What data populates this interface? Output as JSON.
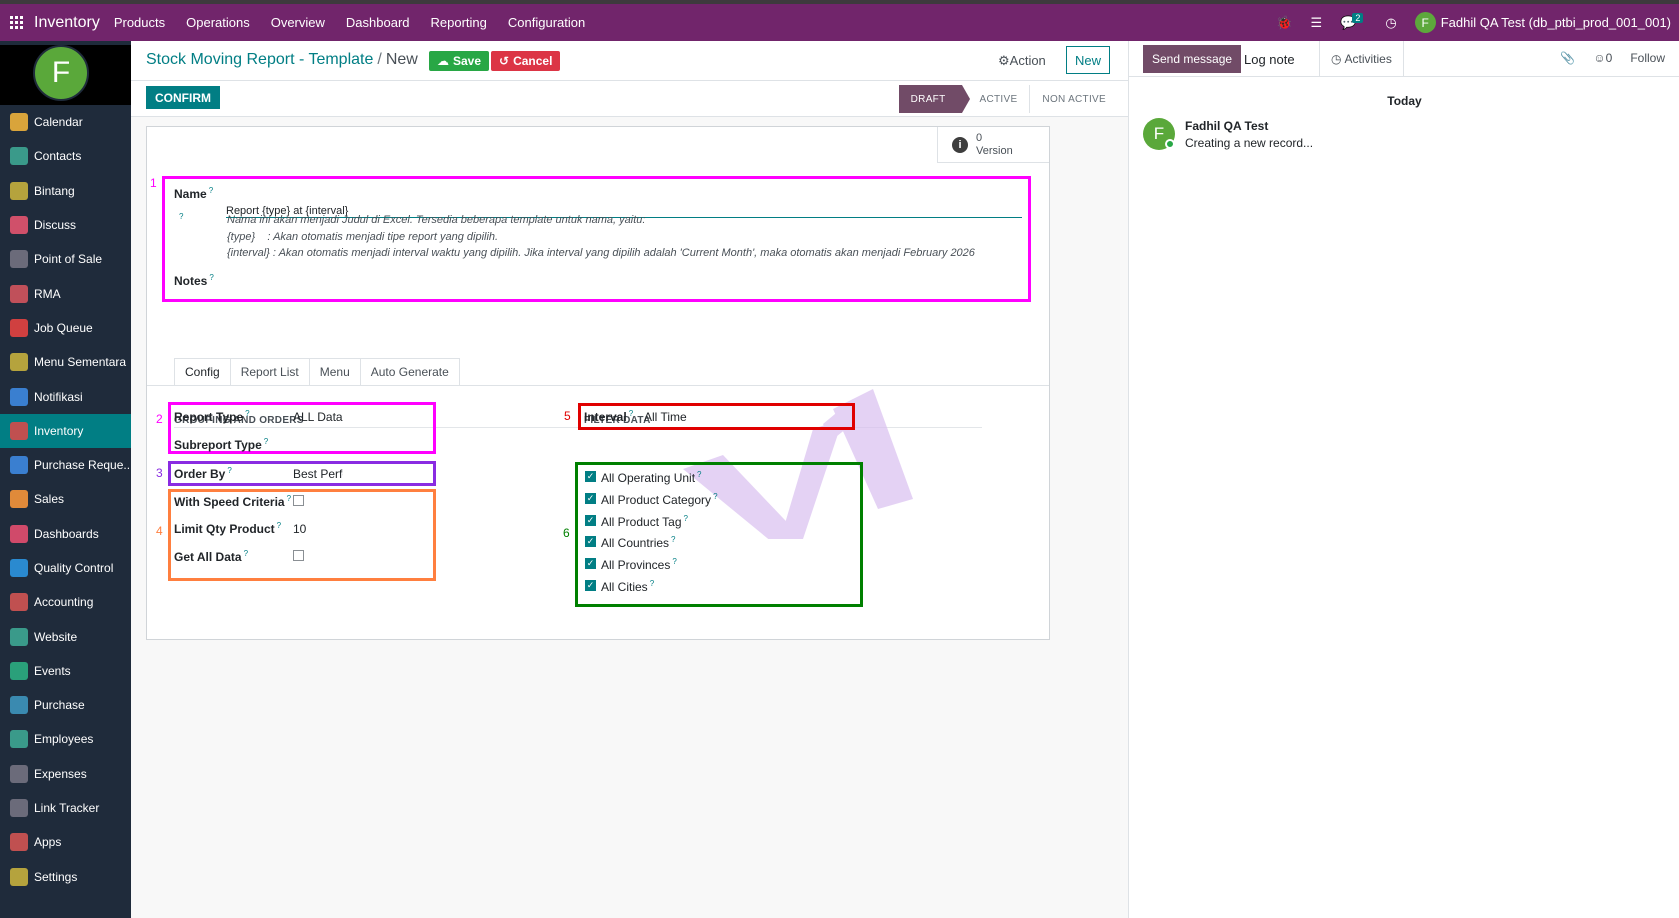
{
  "topbar": {
    "app_title": "Inventory",
    "menu": [
      "Products",
      "Operations",
      "Overview",
      "Dashboard",
      "Reporting",
      "Configuration"
    ],
    "chat_count": "2",
    "user_initial": "F",
    "user_label": "Fadhil QA Test (db_ptbi_prod_001_001)"
  },
  "sidebar": {
    "avatar_initial": "F",
    "items": [
      {
        "label": "Calendar",
        "color": "#d9a43b"
      },
      {
        "label": "Contacts",
        "color": "#3a9a8a"
      },
      {
        "label": "Bintang",
        "color": "#b5a33d"
      },
      {
        "label": "Discuss",
        "color": "#d0506a"
      },
      {
        "label": "Point of Sale",
        "color": "#6b6b7a"
      },
      {
        "label": "RMA",
        "color": "#c0505a"
      },
      {
        "label": "Job Queue",
        "color": "#d04040"
      },
      {
        "label": "Menu Sementara",
        "color": "#b5a33d"
      },
      {
        "label": "Notifikasi",
        "color": "#3a7fd0"
      },
      {
        "label": "Inventory",
        "color": "#c05050"
      },
      {
        "label": "Purchase Reque...",
        "color": "#3a7fd0"
      },
      {
        "label": "Sales",
        "color": "#e08a3a"
      },
      {
        "label": "Dashboards",
        "color": "#d04a6a"
      },
      {
        "label": "Quality Control",
        "color": "#2a8ad0"
      },
      {
        "label": "Accounting",
        "color": "#c05050"
      },
      {
        "label": "Website",
        "color": "#3a9a8a"
      },
      {
        "label": "Events",
        "color": "#2aa07a"
      },
      {
        "label": "Purchase",
        "color": "#3a8ab0"
      },
      {
        "label": "Employees",
        "color": "#3a9a8a"
      },
      {
        "label": "Expenses",
        "color": "#6b6b7a"
      },
      {
        "label": "Link Tracker",
        "color": "#6b6b7a"
      },
      {
        "label": "Apps",
        "color": "#c05050"
      },
      {
        "label": "Settings",
        "color": "#b5a33d"
      }
    ]
  },
  "control": {
    "breadcrumb_parent": "Stock Moving Report - Template",
    "breadcrumb_sep": "/",
    "breadcrumb_current": "New",
    "save_label": "Save",
    "cancel_label": "Cancel",
    "action_label": "Action",
    "new_label": "New"
  },
  "status": {
    "confirm_label": "CONFIRM",
    "stages": [
      "DRAFT",
      "ACTIVE",
      "NON ACTIVE"
    ],
    "current_stage": "DRAFT"
  },
  "smart_button": {
    "count": "0",
    "label": "Version"
  },
  "annotations": {
    "a1": "1",
    "a2": "2",
    "a3": "3",
    "a4": "4",
    "a5": "5",
    "a6": "6",
    "colors": {
      "a1": "#ff00ff",
      "a2": "#ff00ff",
      "a3": "#8a2be2",
      "a4": "#ff7f3f",
      "a5": "#e00000",
      "a6": "#008000"
    }
  },
  "form": {
    "name_label": "Name",
    "name_value": "Report {type} at {interval}",
    "help_q": "?",
    "help_lines": [
      "Nama ini akan menjadi Judul di Excel. Tersedia beberapa template untuk nama, yaitu:",
      "{type}    : Akan otomatis menjadi tipe report yang dipilih.",
      "{interval} : Akan otomatis menjadi interval waktu yang dipilih. Jika interval yang dipilih adalah 'Current Month', maka otomatis akan menjadi February 2026"
    ],
    "notes_label": "Notes",
    "tabs": [
      "Config",
      "Report List",
      "Menu",
      "Auto Generate"
    ],
    "grouping_title": "GROUPING AND ORDERS",
    "filter_title": "FILTER DATA",
    "report_type_label": "Report Type",
    "report_type_value": "ALL Data",
    "subreport_type_label": "Subreport Type",
    "order_by_label": "Order By",
    "order_by_value": "Best Perfo",
    "speed_criteria_label": "With Speed Criteria",
    "speed_criteria_checked": false,
    "limit_qty_label": "Limit Qty Product",
    "limit_qty_value": "10",
    "get_all_label": "Get All Data",
    "get_all_checked": false,
    "interval_label": "Interval",
    "interval_value": "All Time",
    "filters": [
      {
        "label": "All Operating Unit",
        "checked": true
      },
      {
        "label": "All Product Category",
        "checked": true
      },
      {
        "label": "All Product Tag",
        "checked": true
      },
      {
        "label": "All Countries",
        "checked": true
      },
      {
        "label": "All Provinces",
        "checked": true
      },
      {
        "label": "All Cities",
        "checked": true
      }
    ]
  },
  "chatter": {
    "send_label": "Send message",
    "log_label": "Log note",
    "activities_label": "Activities",
    "followers_count": "0",
    "follow_label": "Follow",
    "today_label": "Today",
    "author_initial": "F",
    "author": "Fadhil QA Test",
    "message": "Creating a new record..."
  }
}
